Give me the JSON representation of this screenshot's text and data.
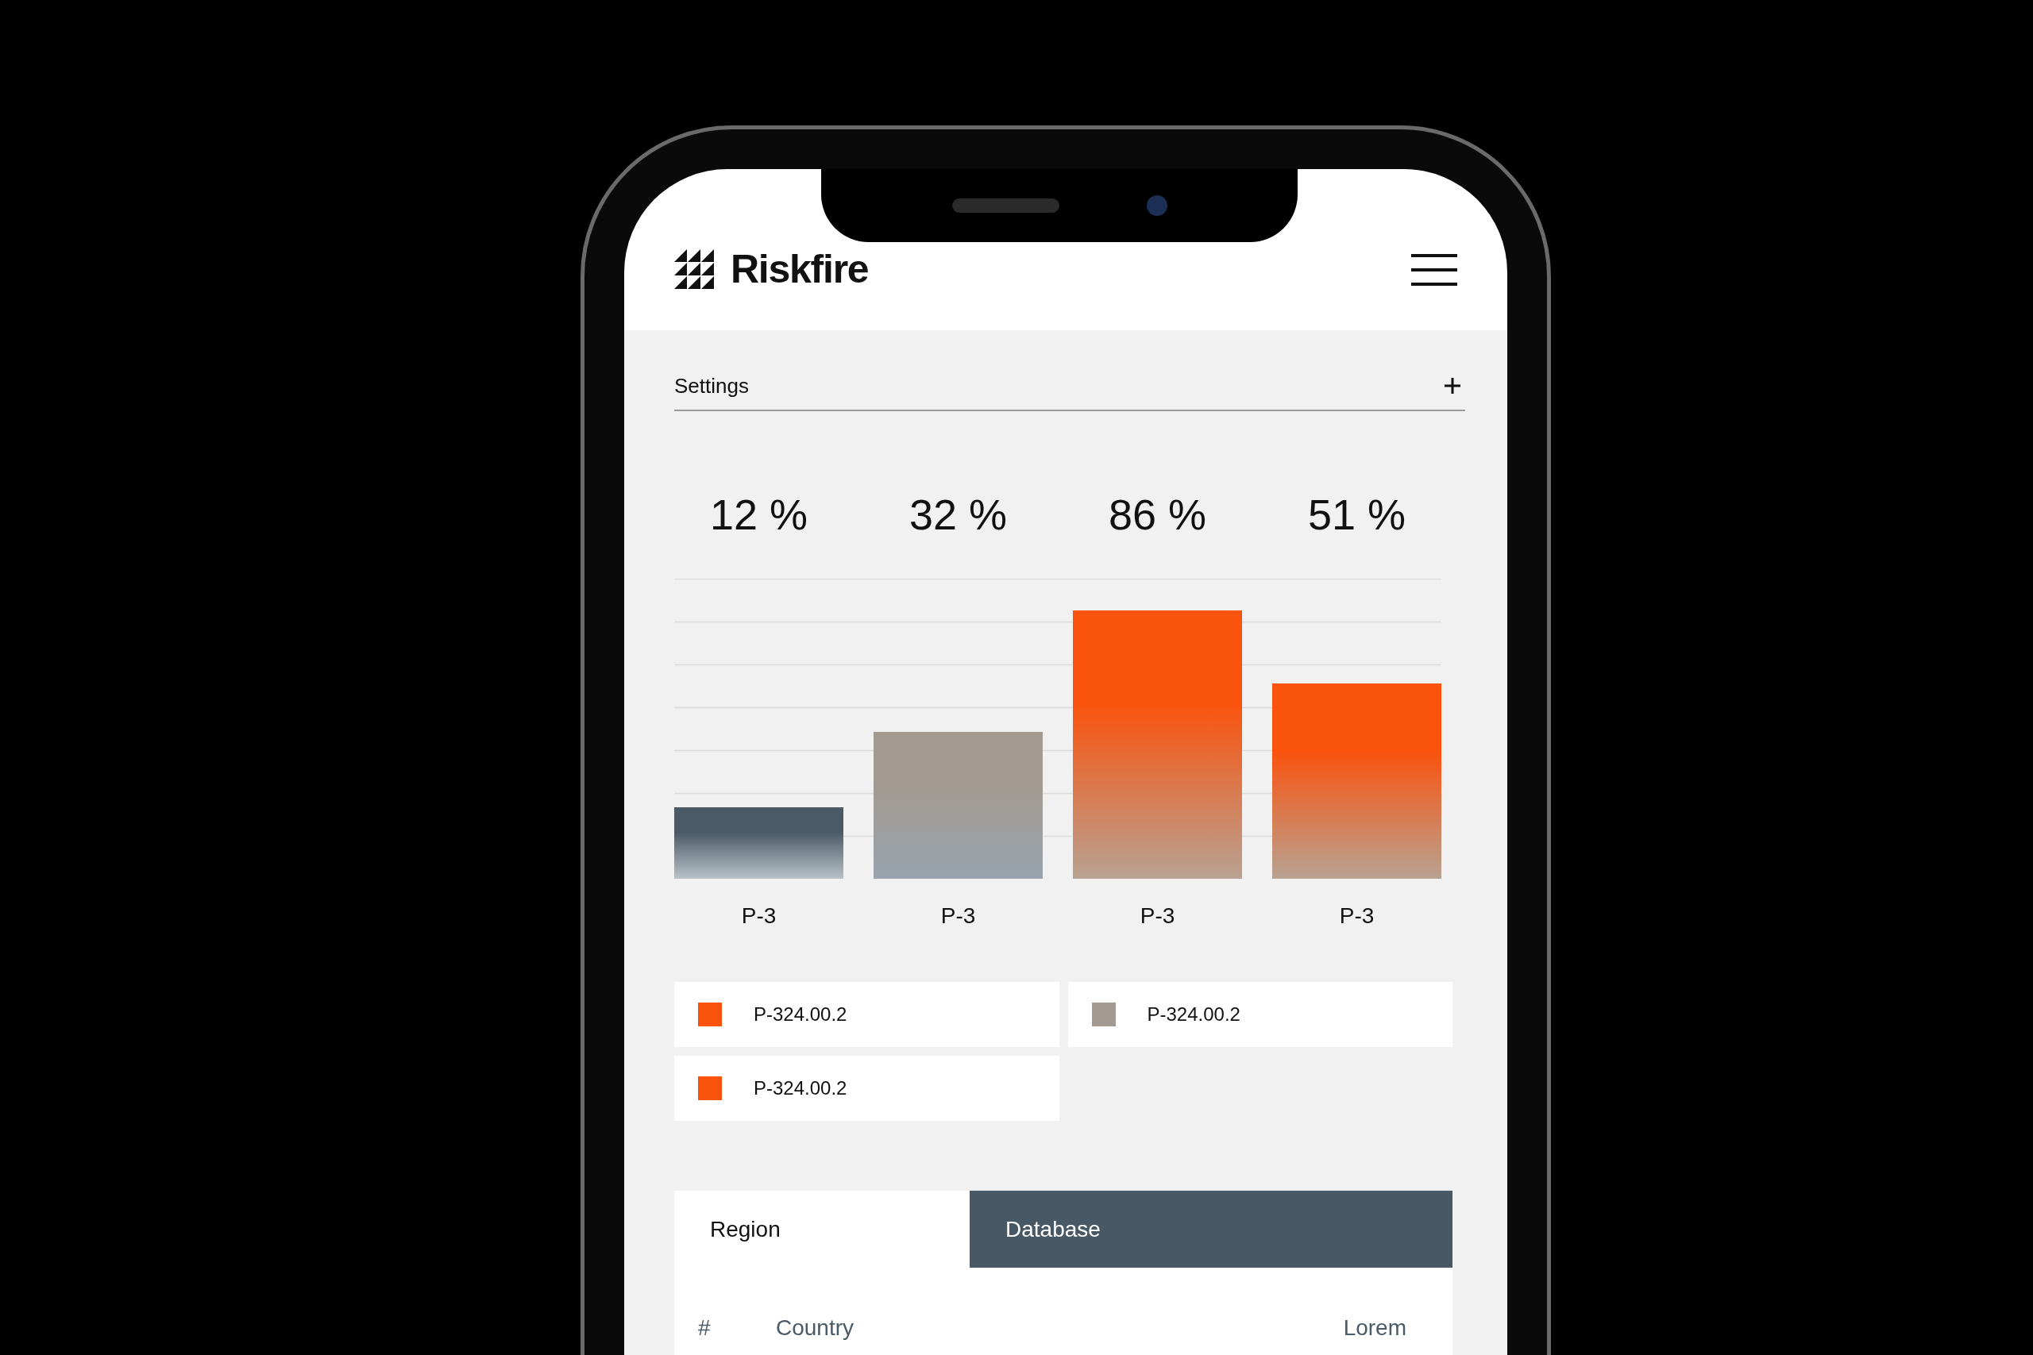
{
  "header": {
    "brand": "Riskfire"
  },
  "settings": {
    "label": "Settings",
    "expanded": false
  },
  "chart": {
    "bars": [
      {
        "value": "12 %",
        "label": "P-3",
        "kind": "slate"
      },
      {
        "value": "32 %",
        "label": "P-3",
        "kind": "taupe"
      },
      {
        "value": "86 %",
        "label": "P-3",
        "kind": "orange"
      },
      {
        "value": "51 %",
        "label": "P-3",
        "kind": "orange"
      }
    ]
  },
  "legend": [
    {
      "label": "P-324.00.2",
      "color": "#fa530e"
    },
    {
      "label": "P-324.00.2",
      "color": "#a39a91"
    },
    {
      "label": "P-324.00.2",
      "color": "#fa530e"
    }
  ],
  "tabs": [
    {
      "label": "Region",
      "selected": true
    },
    {
      "label": "Database",
      "selected": false
    }
  ],
  "table": {
    "columns": [
      "#",
      "Country",
      "Lorem"
    ]
  }
}
